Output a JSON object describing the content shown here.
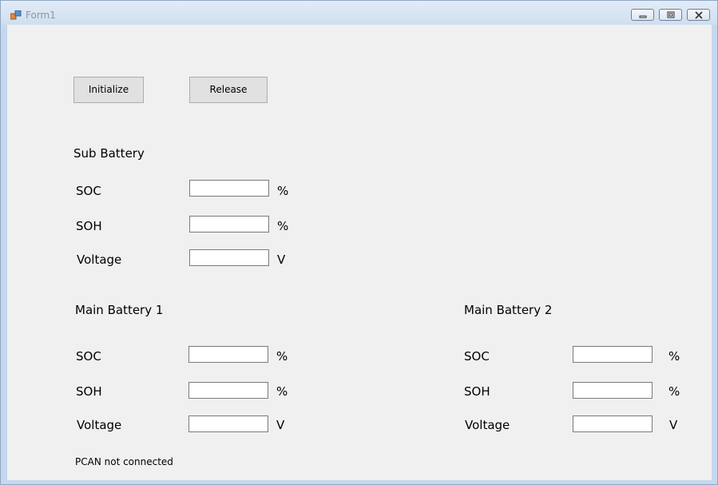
{
  "window": {
    "title": "Form1"
  },
  "toolbar": {
    "initialize_label": "Initialize",
    "release_label": "Release"
  },
  "sub_battery": {
    "title": "Sub Battery",
    "soc": {
      "label": "SOC",
      "value": "",
      "unit": "%"
    },
    "soh": {
      "label": "SOH",
      "value": "",
      "unit": "%"
    },
    "voltage": {
      "label": "Voltage",
      "value": "",
      "unit": "V"
    }
  },
  "main_battery_1": {
    "title": "Main Battery 1",
    "soc": {
      "label": "SOC",
      "value": "",
      "unit": "%"
    },
    "soh": {
      "label": "SOH",
      "value": "",
      "unit": "%"
    },
    "voltage": {
      "label": "Voltage",
      "value": "",
      "unit": "V"
    }
  },
  "main_battery_2": {
    "title": "Main Battery 2",
    "soc": {
      "label": "SOC",
      "value": "",
      "unit": "%"
    },
    "soh": {
      "label": "SOH",
      "value": "",
      "unit": "%"
    },
    "voltage": {
      "label": "Voltage",
      "value": "",
      "unit": "V"
    }
  },
  "status": {
    "text": "PCAN not connected"
  },
  "icons": {
    "app": "app-icon",
    "minimize": "minimize-icon",
    "maximize": "maximize-icon",
    "close": "close-icon"
  }
}
